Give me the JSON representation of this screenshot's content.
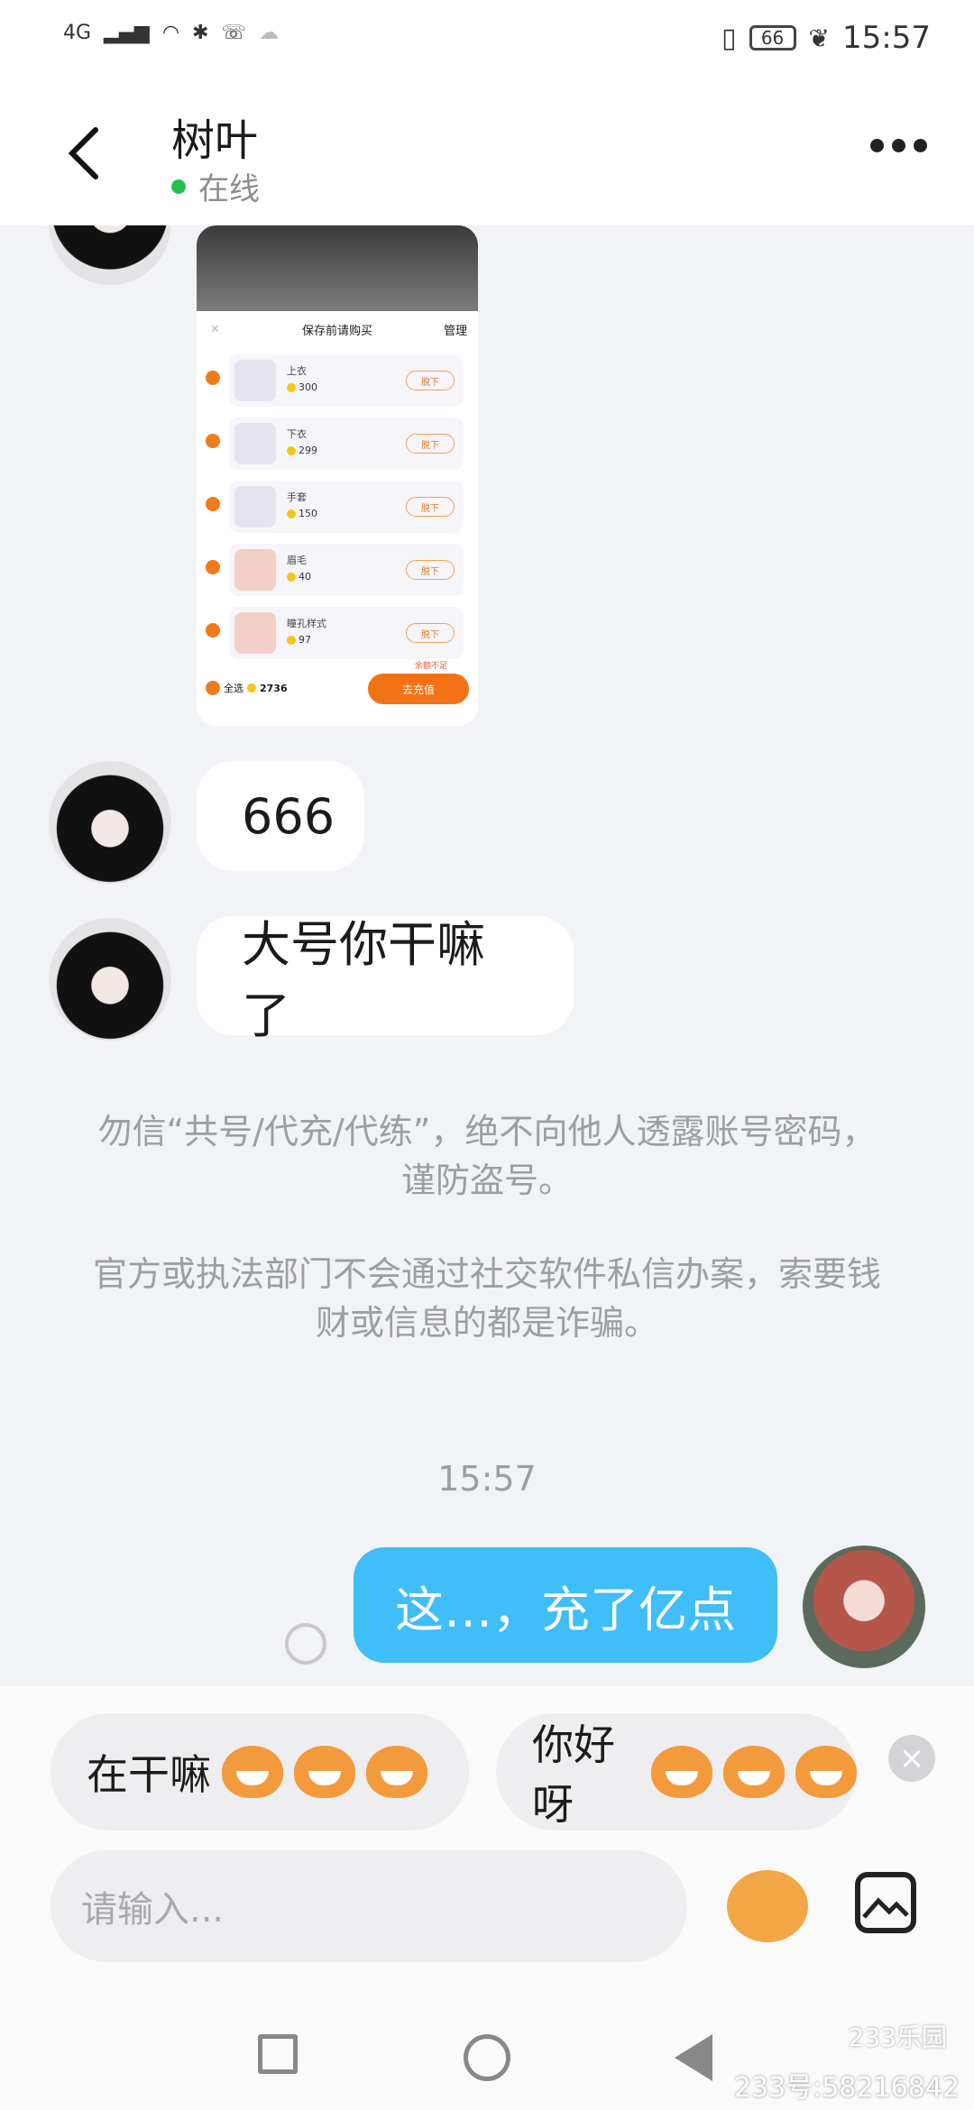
{
  "status_bar": {
    "network": "4G",
    "battery": "66",
    "time": "15:57"
  },
  "header": {
    "title": "树叶",
    "online_status": "在线"
  },
  "shared_image": {
    "panel_title": "保存前请购买",
    "manage_label": "管理",
    "items": [
      {
        "name": "上衣",
        "price": "300",
        "action": "脱下"
      },
      {
        "name": "下衣",
        "price": "299",
        "action": "脱下"
      },
      {
        "name": "手套",
        "price": "150",
        "action": "脱下"
      },
      {
        "name": "眉毛",
        "price": "40",
        "action": "脱下"
      },
      {
        "name": "瞳孔样式",
        "price": "97",
        "action": "脱下"
      }
    ],
    "select_all": "全选",
    "total": "2736",
    "balance_note": "余额不足",
    "pay_button": "去充值"
  },
  "messages": [
    {
      "text": "666"
    },
    {
      "text": "大号你干嘛了"
    }
  ],
  "notices": [
    "勿信“共号/代充/代练”，绝不向他人透露账号密码，谨防盗号。",
    "官方或执法部门不会通过社交软件私信办案，索要钱财或信息的都是诈骗。"
  ],
  "timestamp": "15:57",
  "sent_message": "这…，充了亿点",
  "quick_replies": [
    {
      "text": "在干嘛"
    },
    {
      "text": "你好呀"
    }
  ],
  "input": {
    "placeholder": "请输入..."
  },
  "watermark": {
    "logo": "233乐园",
    "id": "233号:58216842"
  }
}
